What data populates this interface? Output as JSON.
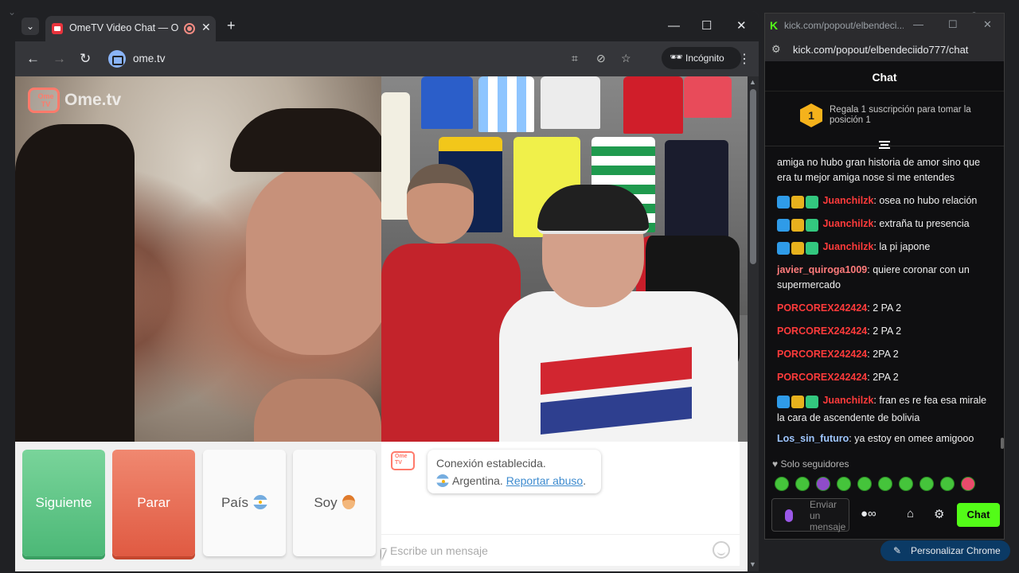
{
  "browser": {
    "tab_title": "OmeTV Video Chat — Ome",
    "url": "ome.tv",
    "incognito_label": "Incógnito",
    "customize_label": "Personalizar Chrome"
  },
  "ome": {
    "logo_badge": "Ome TV",
    "logo_text": "Ome.tv",
    "buttons": {
      "next": "Siguiente",
      "stop": "Parar",
      "country": "País",
      "gender": "Soy"
    },
    "chat": {
      "status": "Conexión establecida.",
      "country": "Argentina.",
      "report": "Reportar abuso",
      "report_suffix": ".",
      "input_placeholder": "Escribe un mensaje"
    }
  },
  "kick": {
    "window_title": "kick.com/popout/elbendeci...",
    "url": "kick.com/popout/elbendeciido777/chat",
    "header": "Chat",
    "sub_banner_badge": "1",
    "sub_banner": "Regala 1 suscripción para tomar la posición 1",
    "messages": [
      {
        "user": "",
        "text": "amiga no hubo gran historia de amor sino que era tu mejor amiga nose si me entendes"
      },
      {
        "user": "Juanchilzk",
        "text": ": osea no hubo relación"
      },
      {
        "user": "Juanchilzk",
        "text": ": extraña tu presencia"
      },
      {
        "user": "Juanchilzk",
        "text": ": la pi japone"
      },
      {
        "user": "javier_quiroga1009",
        "text": ": quiere coronar con un supermercado"
      },
      {
        "user": "PORCOREX242424",
        "text": ": 2 PA 2"
      },
      {
        "user": "PORCOREX242424",
        "text": ": 2 PA 2"
      },
      {
        "user": "PORCOREX242424",
        "text": ": 2PA 2"
      },
      {
        "user": "PORCOREX242424",
        "text": ": 2PA 2"
      },
      {
        "user": "Juanchilzk",
        "text": ": fran es re fea esa miralе la cara de ascendente de bolivia"
      },
      {
        "user": "Los_sin_futuro",
        "text": ": ya estoy en omee amigooo"
      }
    ],
    "followers_only": "Solo seguidores",
    "input_placeholder": "Enviar un mensaje",
    "send_label": "Chat"
  },
  "colors": {
    "kick_green": "#53fc18",
    "ome_green": "#4cb877",
    "ome_red": "#e05a42"
  }
}
